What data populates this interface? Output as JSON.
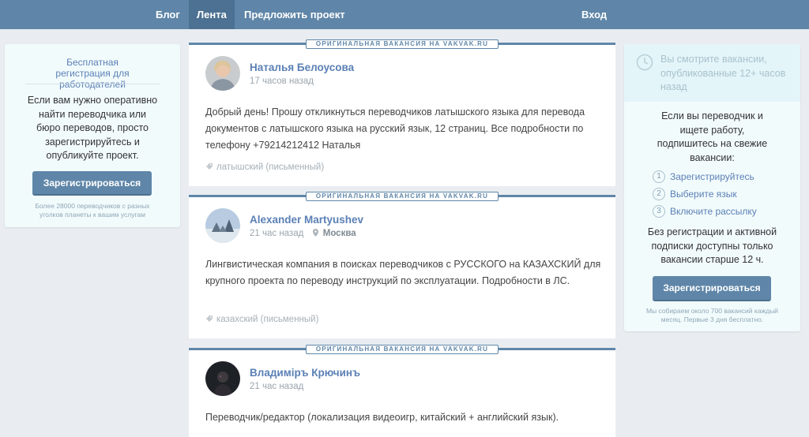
{
  "nav": {
    "blog": "Блог",
    "feed": "Лента",
    "propose": "Предложить проект",
    "login": "Вход"
  },
  "left_card": {
    "title": "Бесплатная регистрация для работодателей",
    "text": "Если вам нужно оперативно найти переводчика или бюро переводов, просто зарегистрируйтесь и опубликуйте проект.",
    "button": "Зарегистрироваться",
    "note": "Более 28000 переводчиков с разных уголков планеты к вашим услугам"
  },
  "right_card": {
    "notice": "Вы смотрите вакансии, опубликованные 12+ часов назад",
    "text": "Если вы переводчик и ищете работу, подпишитесь на свежие вакансии:",
    "steps": [
      {
        "num": "1",
        "label": "Зарегистрируйтесь"
      },
      {
        "num": "2",
        "label": "Выберите язык"
      },
      {
        "num": "3",
        "label": "Включите рассылку"
      }
    ],
    "text2": "Без регистрации и активной подписки доступны только вакансии старше 12 ч.",
    "button": "Зарегистрироваться",
    "note": "Мы собираем около 700 вакансий каждый месяц. Первые 3 дня бесплатно."
  },
  "badge": "ОРИГИНАЛЬНАЯ ВАКАНСИЯ НА VAKVAK.RU",
  "posts": [
    {
      "author": "Наталья Белоусова",
      "time": "17 часов назад",
      "location": "",
      "text": "Добрый день! Прошу откликнуться переводчиков латышского языка для перевода документов с латышского языка на русский язык, 12 страниц. Все подробности по телефону +79214212412 Наталья",
      "tag": "латышский (письменный)"
    },
    {
      "author": "Alexander Martyushev",
      "time": "21 час назад",
      "location": "Москва",
      "text": "Лингвистическая компания в поисках переводчиков с РУССКОГО на КАЗАХСКИЙ для крупного проекта по переводу инструкций по эксплуатации. Подробности в ЛС.",
      "tag": "казахский (письменный)"
    },
    {
      "author": "Владиміръ Крючинъ",
      "time": "21 час назад",
      "location": "",
      "text": "Переводчик/редактор (локализация видеоигр, китайский + английский язык).",
      "tag": ""
    }
  ],
  "colors": {
    "nav_bg": "#5f86a8",
    "nav_active": "#4c7192",
    "link": "#5b80b5",
    "page_bg": "#e9edf1",
    "card_bg": "#f2fbfc"
  }
}
